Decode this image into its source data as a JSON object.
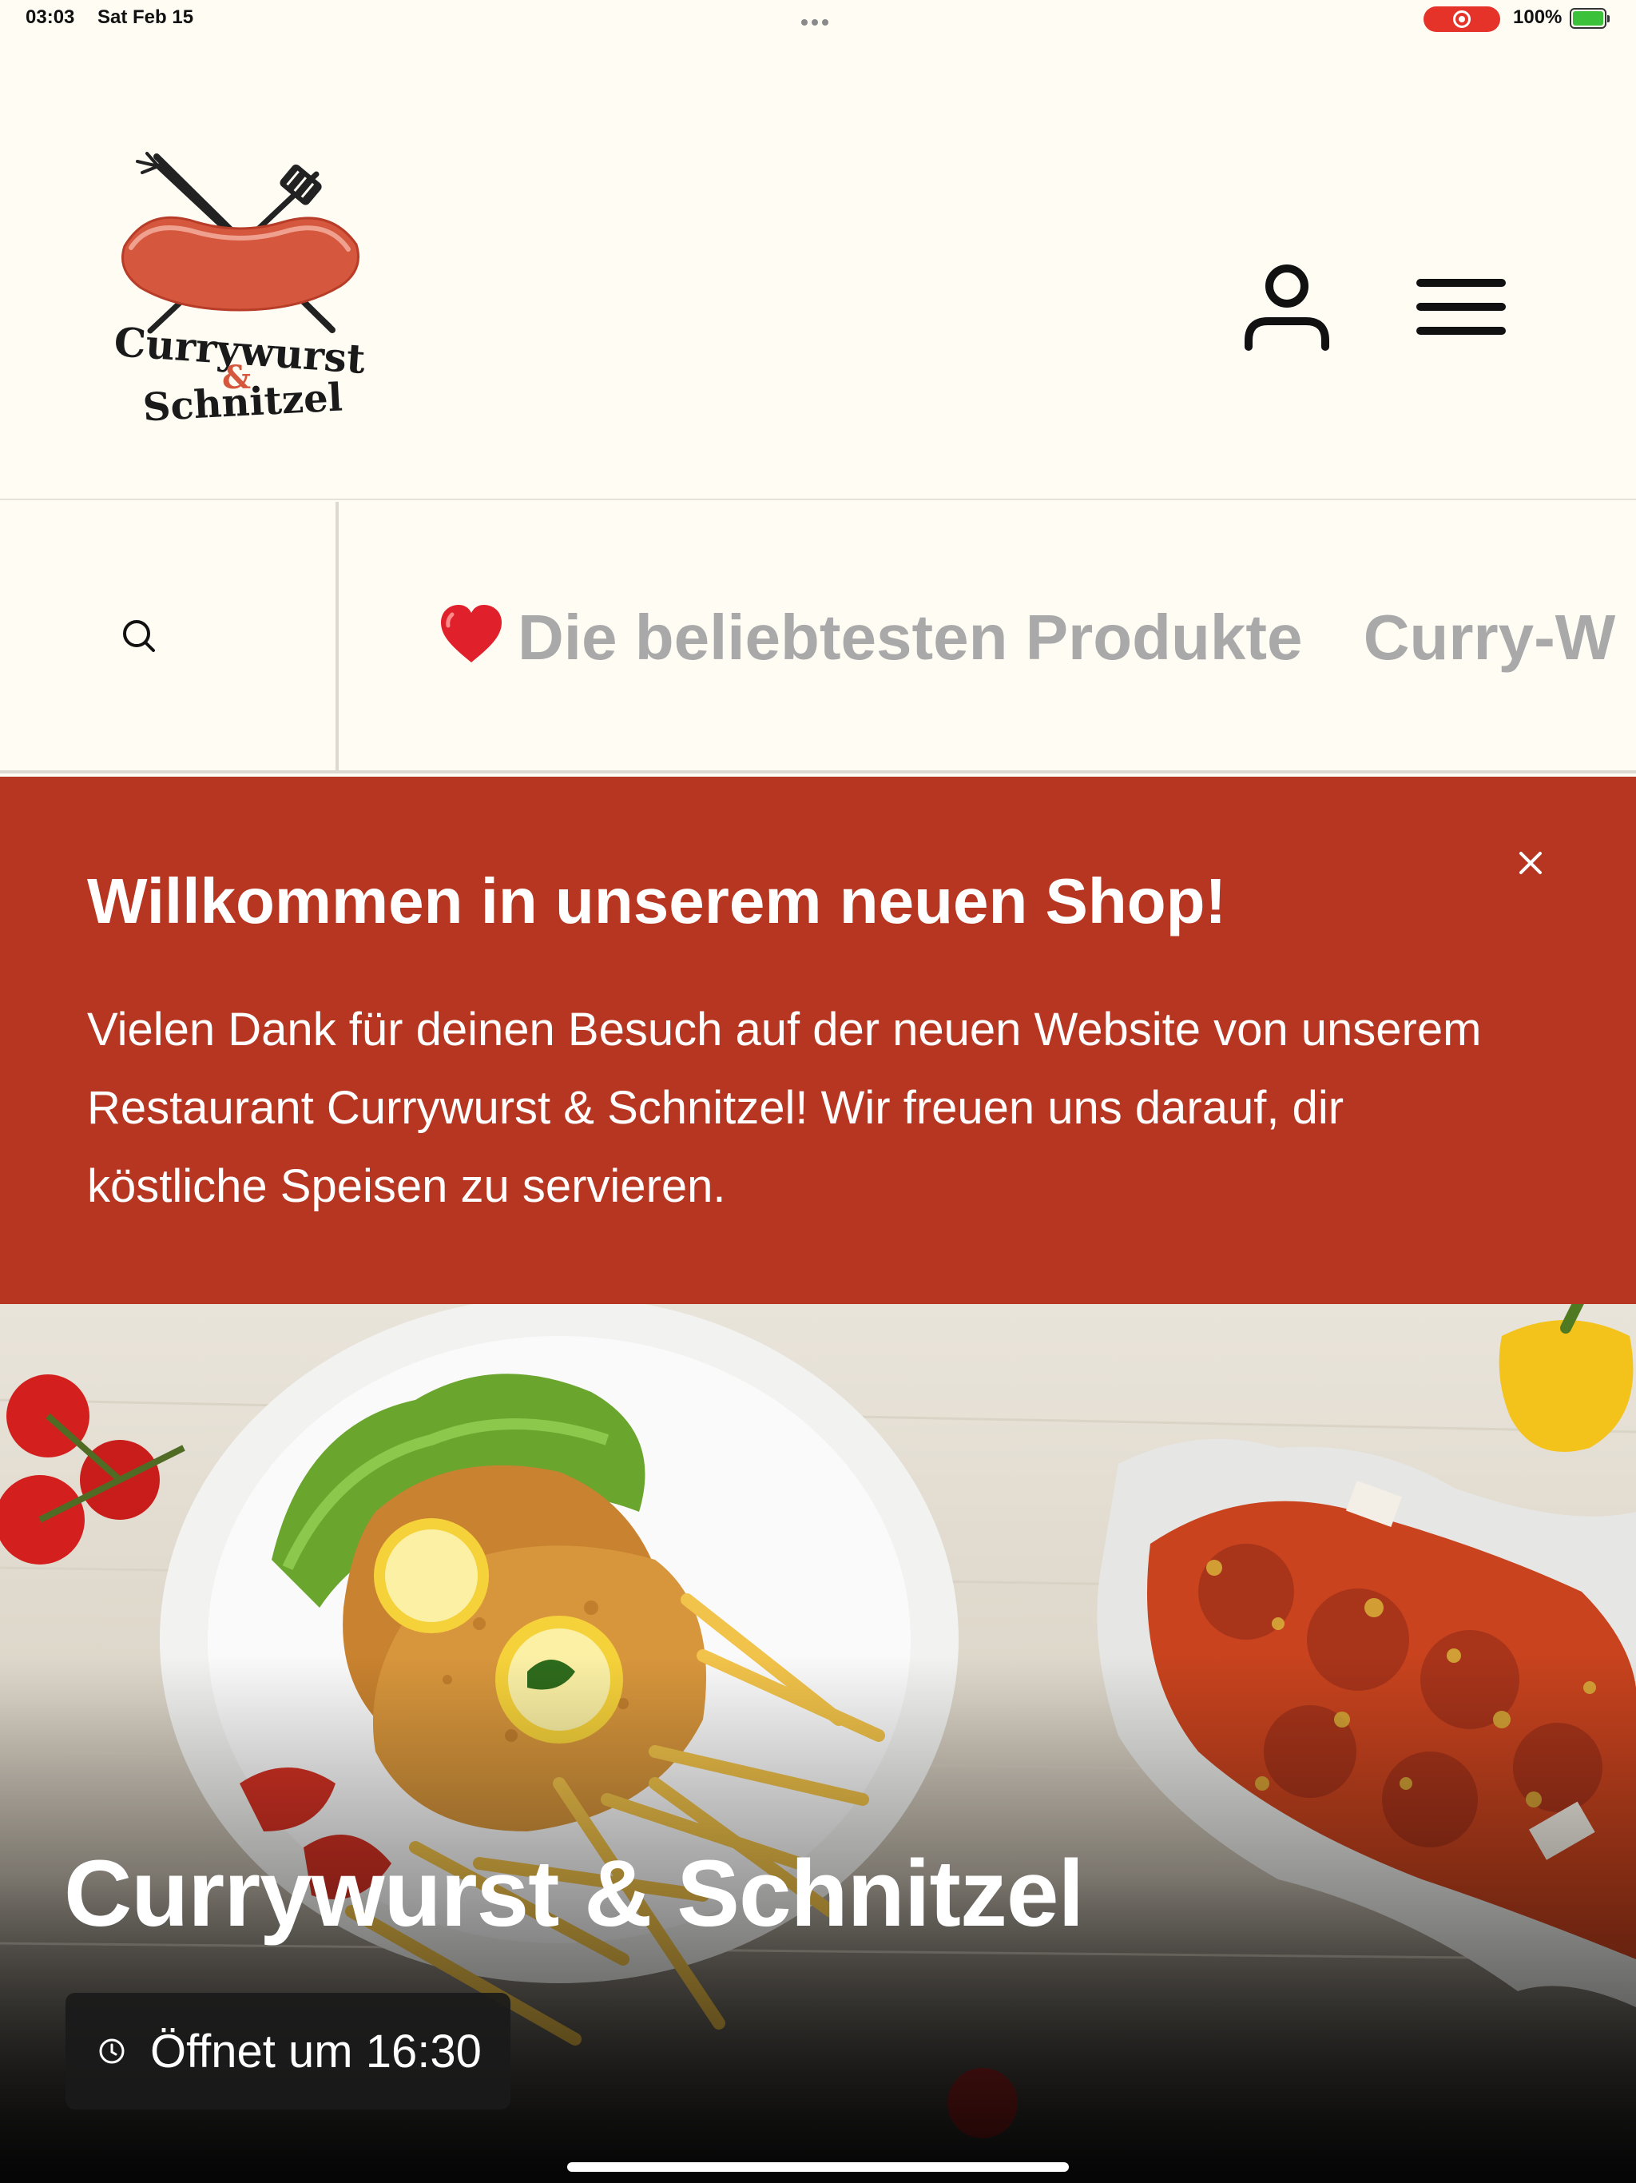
{
  "status_bar": {
    "time": "03:03",
    "date": "Sat Feb 15",
    "battery": "100%"
  },
  "logo": {
    "line1": "Currywurst",
    "ampersand": "&",
    "line2": "Schnitzel"
  },
  "nav": {
    "items": [
      {
        "label": "Die beliebtesten Produkte",
        "icon": "heart-icon"
      },
      {
        "label": "Curry-W"
      }
    ]
  },
  "announcement": {
    "title": "Willkommen in unserem neuen Shop!",
    "text": "Vielen Dank für deinen Besuch auf der neuen Website von unserem Restaurant Currywurst & Schnitzel! Wir freuen uns darauf, dir köstliche Speisen zu servieren.",
    "background": "#b73622"
  },
  "hero": {
    "title": "Currywurst & Schnitzel",
    "hours": "Öffnet um 16:30"
  },
  "colors": {
    "page_background": "#fffcf4",
    "accent": "#b73622",
    "nav_text": "#a9a9a9"
  }
}
